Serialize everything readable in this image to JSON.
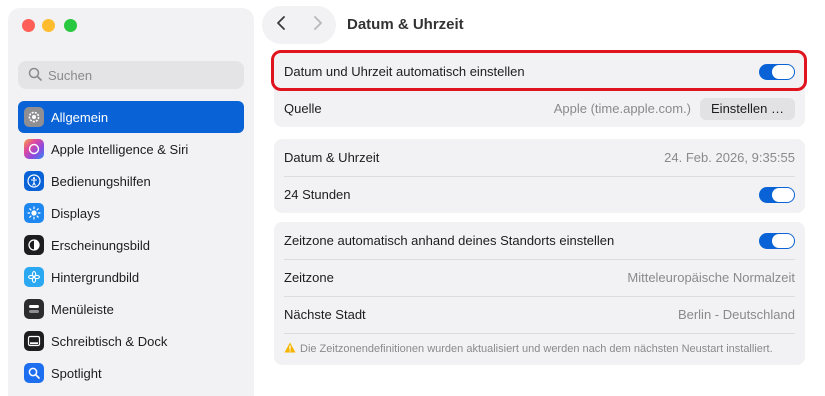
{
  "window": {
    "title": "Datum & Uhrzeit"
  },
  "search": {
    "placeholder": "Suchen"
  },
  "sidebar": {
    "items": [
      {
        "label": "Allgemein",
        "icon": "gear-icon",
        "color": "#8e8e93",
        "active": true
      },
      {
        "label": "Apple Intelligence & Siri",
        "icon": "siri-icon",
        "color": "#c04bd8"
      },
      {
        "label": "Bedienungshilfen",
        "icon": "accessibility-icon",
        "color": "#0a63d6"
      },
      {
        "label": "Displays",
        "icon": "sun-icon",
        "color": "#1e88f0"
      },
      {
        "label": "Erscheinungsbild",
        "icon": "appearance-icon",
        "color": "#1d1d1f"
      },
      {
        "label": "Hintergrundbild",
        "icon": "flower-icon",
        "color": "#2aa8f2"
      },
      {
        "label": "Menüleiste",
        "icon": "menubar-icon",
        "color": "#2c2c2e"
      },
      {
        "label": "Schreibtisch & Dock",
        "icon": "dock-icon",
        "color": "#1d1d1f"
      },
      {
        "label": "Spotlight",
        "icon": "magnifier-icon",
        "color": "#1e6ff0"
      }
    ]
  },
  "groups": {
    "sync": {
      "auto_label": "Datum und Uhrzeit automatisch einstellen",
      "auto_on": true,
      "source_label": "Quelle",
      "source_value": "Apple (time.apple.com.)",
      "source_button": "Einstellen …"
    },
    "datetime": {
      "label": "Datum & Uhrzeit",
      "value": "24. Feb. 2026, 9:35:55",
      "hour24_label": "24 Stunden",
      "hour24_on": true
    },
    "timezone": {
      "auto_label": "Zeitzone automatisch anhand deines Standorts einstellen",
      "auto_on": true,
      "zone_label": "Zeitzone",
      "zone_value": "Mitteleuropäische Normalzeit",
      "city_label": "Nächste Stadt",
      "city_value": "Berlin - Deutschland",
      "note": "Die Zeitzonendefinitionen wurden aktualisiert und werden nach dem nächsten Neustart installiert."
    }
  },
  "colors": {
    "accent": "#0a63d6",
    "highlight": "#e0141e",
    "warning": "#f5b400"
  }
}
